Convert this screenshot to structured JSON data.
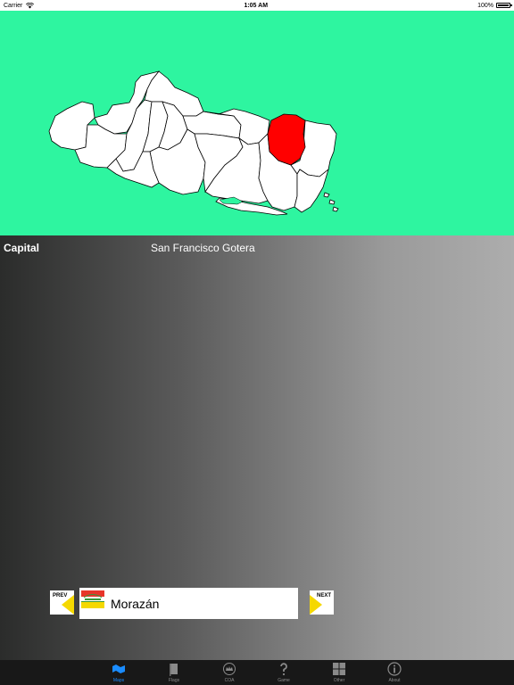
{
  "status_bar": {
    "carrier": "Carrier",
    "time": "1:05 AM",
    "battery": "100%",
    "wifi_icon": "wifi-icon",
    "battery_icon": "battery-icon"
  },
  "map": {
    "highlighted_region": "Morazán",
    "background_color": "#2ef5a0",
    "highlight_color": "#ff0000"
  },
  "info": {
    "capital_label": "Capital",
    "capital_value": "San Francisco Gotera"
  },
  "navigator": {
    "prev_label": "PREV",
    "next_label": "NEXT",
    "region_name": "Morazán",
    "arrow_color": "#f5d800"
  },
  "tabs": [
    {
      "label": "Maps",
      "icon": "map-icon",
      "active": true
    },
    {
      "label": "Flags",
      "icon": "flag-icon",
      "active": false
    },
    {
      "label": "COA",
      "icon": "coat-of-arms-icon",
      "active": false
    },
    {
      "label": "Game",
      "icon": "question-mark-icon",
      "active": false
    },
    {
      "label": "Other",
      "icon": "grid-icon",
      "active": false
    },
    {
      "label": "About",
      "icon": "info-icon",
      "active": false
    }
  ]
}
